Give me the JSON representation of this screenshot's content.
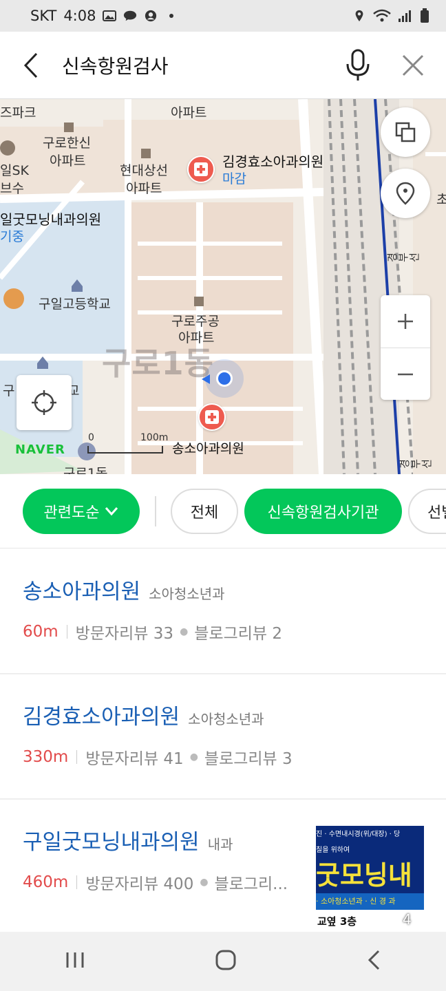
{
  "status_bar": {
    "carrier": "SKT",
    "time": "4:08"
  },
  "search": {
    "query": "신속항원검사"
  },
  "map": {
    "labels": {
      "top_apt": "아파트",
      "guro_hansin": "구로한신",
      "guro_hansin_apt": "아파트",
      "hyundai": "현대상선",
      "hyundai_apt": "아파트",
      "gimkyunghyo": "김경효소아과의원",
      "gimkyunghyo_status": "마감",
      "iljsk": "일SK",
      "bs": "브수",
      "jpark": "즈파크",
      "guil_goodmorning": "일굿모닝내과의원",
      "guil_goodmorning_status": "기중",
      "guil_highschool": "구일고등학교",
      "guro_jugong": "구로주공",
      "guro_jugong_apt": "아파트",
      "district": "구로1동",
      "song_clinic": "송소아과의원",
      "left_edge_1": "구",
      "left_edge_2": "교",
      "bottom_partial": "구로1동",
      "gyeongbu_1": "경부선",
      "gyeongbu_2": "경부선",
      "right_char": "초"
    },
    "brand": "NAVER",
    "scale": {
      "zero": "0",
      "distance": "100m"
    }
  },
  "filters": {
    "sort": "관련도순",
    "all": "전체",
    "category": "신속항원검사기관",
    "partial": "선별"
  },
  "results": [
    {
      "name": "송소아과의원",
      "category": "소아청소년과",
      "distance": "60m",
      "visitor_reviews": "방문자리뷰 33",
      "blog_reviews": "블로그리뷰 2"
    },
    {
      "name": "김경효소아과의원",
      "category": "소아청소년과",
      "distance": "330m",
      "visitor_reviews": "방문자리뷰 41",
      "blog_reviews": "블로그리뷰 3"
    },
    {
      "name": "구일굿모닝내과의원",
      "category": "내과",
      "distance": "460m",
      "visitor_reviews": "방문자리뷰 400",
      "blog_reviews": "블로그리...",
      "thumb": {
        "line1": "진 · 수면내시경(위/대장) · 당",
        "line2": "칠을 위하여",
        "line3": "굿모닝내",
        "line4": "· 소아청소년과 · 신 경 과",
        "line5": "교옆 3층",
        "count": "4"
      }
    }
  ],
  "colors": {
    "accent_green": "#03c75a",
    "link_blue": "#1a5fb4",
    "distance_red": "#e24b4b",
    "pin_red": "#ee5b4f"
  }
}
